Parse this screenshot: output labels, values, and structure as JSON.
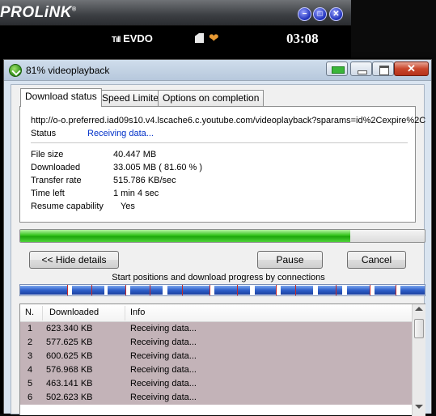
{
  "prolink": {
    "logo": "PROLiNK",
    "registered": "®",
    "network": "EVDO",
    "signal_bars": "Tıll",
    "clock": "03:08",
    "buttons": {
      "minimize": "−",
      "restore": "□",
      "close": "✕"
    },
    "icons": [
      "signal-icon",
      "sms-icon",
      "heart-icon"
    ]
  },
  "window": {
    "title": "81% videoplayback",
    "controls": {
      "close": "✕"
    }
  },
  "tabs": [
    "Download status",
    "Speed Limiter",
    "Options on completion"
  ],
  "status": {
    "url": "http://o-o.preferred.iad09s10.v4.lscache6.c.youtube.com/videoplayback?sparams=id%2Cexpire%2C",
    "status_label": "Status",
    "status_value": "Receiving data...",
    "rows": [
      {
        "key": "File size",
        "value": "40.447  MB"
      },
      {
        "key": "Downloaded",
        "value": "33.005  MB  ( 81.60 % )"
      },
      {
        "key": "Transfer rate",
        "value": "515.786  KB/sec"
      },
      {
        "key": "Time left",
        "value": "1 min 4 sec"
      },
      {
        "key": "Resume capability",
        "value": "   Yes"
      }
    ]
  },
  "progress": {
    "percent": 81.6
  },
  "buttons": {
    "hide_details": "<< Hide details",
    "pause": "Pause",
    "cancel": "Cancel"
  },
  "connections": {
    "caption": "Start positions and download progress by connections"
  },
  "list": {
    "headers": [
      "N.",
      "Downloaded",
      "Info"
    ],
    "rows": [
      {
        "n": "1",
        "downloaded": "623.340  KB",
        "info": "Receiving data..."
      },
      {
        "n": "2",
        "downloaded": "577.625  KB",
        "info": "Receiving data..."
      },
      {
        "n": "3",
        "downloaded": "600.625  KB",
        "info": "Receiving data..."
      },
      {
        "n": "4",
        "downloaded": "576.968  KB",
        "info": "Receiving data..."
      },
      {
        "n": "5",
        "downloaded": "463.141  KB",
        "info": "Receiving data..."
      },
      {
        "n": "6",
        "downloaded": "502.623  KB",
        "info": "Receiving data..."
      }
    ]
  },
  "colors": {
    "progress_green": "#35c41d",
    "connection_blue": "#2f5fc9",
    "status_blue": "#0030c8",
    "row_highlight": "#c3b3b8"
  }
}
